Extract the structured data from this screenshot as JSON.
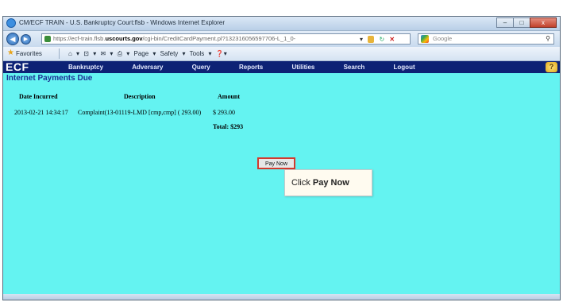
{
  "window": {
    "title": "CM/ECF TRAIN - U.S. Bankruptcy Court:flsb - Windows Internet Explorer",
    "controls": [
      "–",
      "□",
      "x"
    ]
  },
  "address": {
    "url_prefix": "https://ecf-train.flsb.",
    "url_domain": "uscourts.gov",
    "url_path": "/cgi-bin/CreditCardPayment.pl?132316056597706-L_1_0-",
    "search_placeholder": "Google"
  },
  "favorites_bar": {
    "label": "Favorites",
    "tools": "⌂ ▾ ⊡ ▾ ✉ ▾ ⎙ ▾ Page ▾ Safety ▾ Tools ▾ ❓▾"
  },
  "ecf_menu": {
    "logo": "ECF",
    "items": [
      "Bankruptcy",
      "Adversary",
      "Query",
      "Reports",
      "Utilities",
      "Search",
      "Logout"
    ]
  },
  "page": {
    "title": "Internet Payments Due",
    "headers": [
      "Date Incurred",
      "Description",
      "Amount"
    ],
    "row": {
      "date": "2013-02-21 14:34:17",
      "description": "Complaint(13-01119-LMD [cmp,cmp] ( 293.00)",
      "amount": "$ 293.00"
    },
    "total": "Total: $293",
    "pay_button": "Pay Now"
  },
  "callout": {
    "prefix": "Click",
    "emphasis": "Pay Now"
  }
}
